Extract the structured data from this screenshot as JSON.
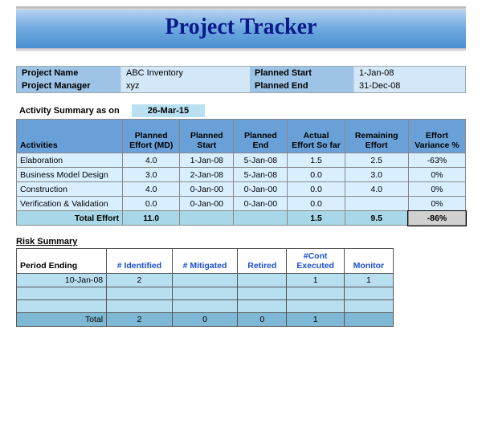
{
  "title": "Project Tracker",
  "info": {
    "project_name_label": "Project Name",
    "project_name": "ABC Inventory",
    "project_manager_label": "Project Manager",
    "project_manager": "xyz",
    "planned_start_label": "Planned Start",
    "planned_start": "1-Jan-08",
    "planned_end_label": "Planned End",
    "planned_end": "31-Dec-08"
  },
  "activity": {
    "heading": "Activity Summary as on",
    "as_on_date": "26-Mar-15",
    "cols": {
      "activities": "Activities",
      "planned_effort": "Planned Effort (MD)",
      "planned_start": "Planned Start",
      "planned_end": "Planned End",
      "actual_effort": "Actual Effort So far",
      "remaining": "Remaining Effort",
      "variance": "Effort Variance %"
    },
    "rows": [
      {
        "name": "Elaboration",
        "planned_effort": "4.0",
        "planned_start": "1-Jan-08",
        "planned_end": "5-Jan-08",
        "actual": "1.5",
        "remaining": "2.5",
        "variance": "-63%"
      },
      {
        "name": "Business Model Design",
        "planned_effort": "3.0",
        "planned_start": "2-Jan-08",
        "planned_end": "5-Jan-08",
        "actual": "0.0",
        "remaining": "3.0",
        "variance": "0%"
      },
      {
        "name": "Construction",
        "planned_effort": "4.0",
        "planned_start": "0-Jan-00",
        "planned_end": "0-Jan-00",
        "actual": "0.0",
        "remaining": "4.0",
        "variance": "0%"
      },
      {
        "name": "Verification & Validation",
        "planned_effort": "0.0",
        "planned_start": "0-Jan-00",
        "planned_end": "0-Jan-00",
        "actual": "0.0",
        "remaining": "",
        "variance": "0%"
      }
    ],
    "total": {
      "label": "Total Effort",
      "planned_effort": "11.0",
      "actual": "1.5",
      "remaining": "9.5",
      "variance": "-86%"
    }
  },
  "risk": {
    "heading": "Risk Summary",
    "cols": {
      "period": "Period Ending",
      "identified": "# Identified",
      "mitigated": "# Mitigated",
      "retired": "Retired",
      "cont": "#Cont Executed",
      "monitor": "Monitor"
    },
    "rows": [
      {
        "period": "10-Jan-08",
        "identified": "2",
        "mitigated": "",
        "retired": "",
        "cont": "1",
        "monitor": "1"
      }
    ],
    "total": {
      "label": "Total",
      "identified": "2",
      "mitigated": "0",
      "retired": "0",
      "cont": "1",
      "monitor": ""
    }
  }
}
